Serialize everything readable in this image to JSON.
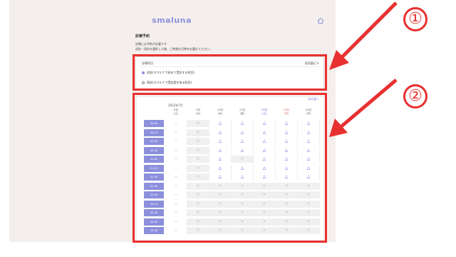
{
  "header": {
    "logo": "smaluna",
    "home_icon": "home-icon"
  },
  "intro": {
    "title": "診療予約",
    "line1": "診療には予約が必要です",
    "line2": "初診・再診を選択した後、ご希望の日時をお選びください。"
  },
  "department": {
    "label": "診療科目",
    "link": "低用量ピル",
    "options": [
      {
        "label": "初診(スマルナで初めて受診する科目)",
        "selected": true
      },
      {
        "label": "再診(スマルナで受診歴がある科目)",
        "selected": false
      }
    ]
  },
  "calendar": {
    "next_label": "次の週へ",
    "month": "2022年7月",
    "days": [
      {
        "date": "8日",
        "dow": "(土)",
        "kind": "weekday"
      },
      {
        "date": "9日",
        "dow": "(水)",
        "kind": "weekday"
      },
      {
        "date": "10日",
        "dow": "(木)",
        "kind": "weekday"
      },
      {
        "date": "11日",
        "dow": "(金)",
        "kind": "weekday"
      },
      {
        "date": "12日",
        "dow": "(土)",
        "kind": "sat"
      },
      {
        "date": "13日",
        "dow": "(日)",
        "kind": "sun"
      },
      {
        "date": "14日",
        "dow": "(月)",
        "kind": "weekday"
      }
    ],
    "rows": [
      {
        "time": "00:00",
        "cells": [
          "–",
          "×",
          "△",
          "△",
          "△",
          "△",
          "△"
        ]
      },
      {
        "time": "00:15",
        "cells": [
          "–",
          "×",
          "△",
          "△",
          "△",
          "△",
          "△"
        ]
      },
      {
        "time": "00:30",
        "cells": [
          "–",
          "×",
          "△",
          "△",
          "△",
          "△",
          "△"
        ]
      },
      {
        "time": "00:45",
        "cells": [
          "–",
          "×",
          "△",
          "△",
          "△",
          "△",
          "△"
        ]
      },
      {
        "time": "01:00",
        "cells": [
          "–",
          "×",
          "△",
          "×",
          "△",
          "△",
          "△"
        ]
      },
      {
        "time": "01:15",
        "cells": [
          "–",
          "×",
          "△",
          "△",
          "△",
          "△",
          "△"
        ]
      },
      {
        "time": "01:30",
        "cells": [
          "–",
          "×",
          "△",
          "△",
          "△",
          "△",
          "△"
        ]
      },
      {
        "time": "01:45",
        "cells": [
          "–",
          "×",
          "×",
          "×",
          "×",
          "×",
          "×"
        ]
      },
      {
        "time": "02:00",
        "cells": [
          "–",
          "×",
          "×",
          "×",
          "×",
          "×",
          "×"
        ]
      },
      {
        "time": "02:15",
        "cells": [
          "–",
          "×",
          "×",
          "×",
          "×",
          "×",
          "×"
        ]
      },
      {
        "time": "02:30",
        "cells": [
          "–",
          "×",
          "×",
          "×",
          "×",
          "×",
          "×"
        ]
      },
      {
        "time": "02:45",
        "cells": [
          "–",
          "×",
          "×",
          "×",
          "×",
          "×",
          "×"
        ]
      },
      {
        "time": "03:00",
        "cells": [
          "–",
          "×",
          "×",
          "×",
          "×",
          "×",
          "×"
        ]
      }
    ]
  },
  "annotations": {
    "marker1": "①",
    "marker2": "②",
    "color": "#e83030"
  }
}
